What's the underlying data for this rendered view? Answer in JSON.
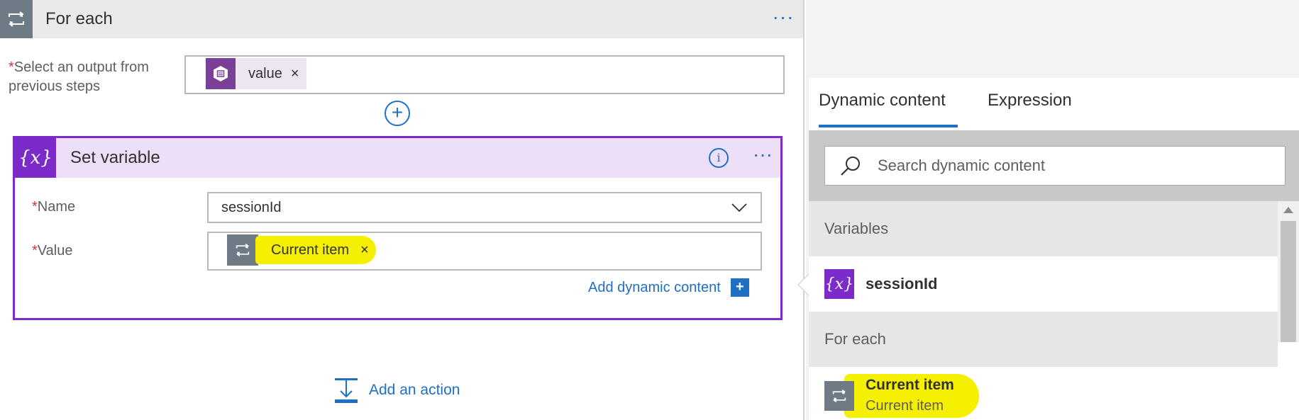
{
  "foreach": {
    "title": "For each",
    "more_label": "···",
    "select_label": "Select an output from previous steps",
    "required_mark": "*",
    "token": {
      "label": "value",
      "remove": "×",
      "icon": "parse-json-icon"
    }
  },
  "set_variable": {
    "title": "Set variable",
    "icon_text": "{x}",
    "info_text": "i",
    "more_label": "···",
    "name_label": "Name",
    "name_value": "sessionId",
    "value_label": "Value",
    "value_token": {
      "label": "Current item",
      "remove": "×"
    },
    "add_dynamic_label": "Add dynamic content",
    "add_dynamic_icon": "+"
  },
  "add_action": {
    "label": "Add an action"
  },
  "plus_label": "+",
  "panel": {
    "tabs": [
      {
        "label": "Dynamic content",
        "active": true
      },
      {
        "label": "Expression",
        "active": false
      }
    ],
    "search_placeholder": "Search dynamic content",
    "sections": [
      {
        "header": "Variables",
        "items": [
          {
            "title": "sessionId",
            "icon_text": "{x}"
          }
        ]
      },
      {
        "header": "For each",
        "items": [
          {
            "title": "Current item",
            "subtitle": "Current item"
          }
        ]
      }
    ]
  },
  "colors": {
    "accent_blue": "#1f6fc5",
    "variable_purple": "#7a2bc9",
    "foreach_gray": "#6e7a85",
    "highlight_yellow": "#f4f000",
    "required_red": "#d13438"
  }
}
